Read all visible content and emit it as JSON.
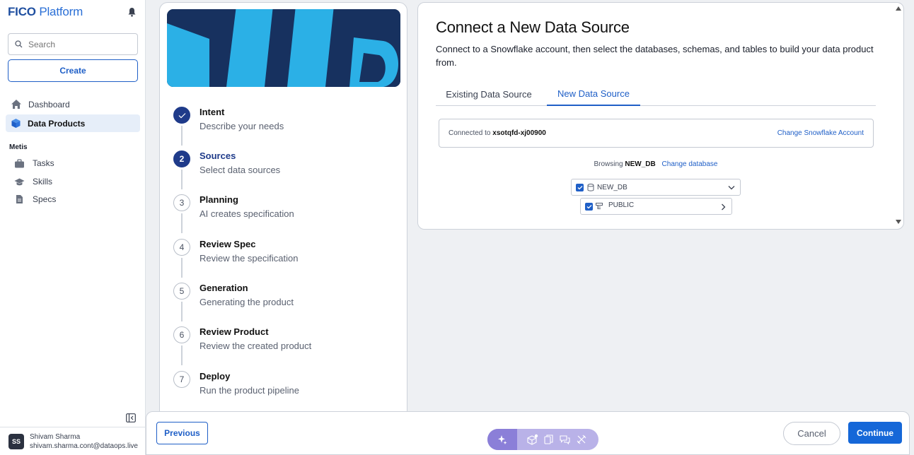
{
  "app": {
    "brand_bold": "FICO",
    "brand_rest": "Platform"
  },
  "sidebar": {
    "search_placeholder": "Search",
    "create_label": "Create",
    "nav": [
      {
        "label": "Dashboard",
        "icon": "home-icon"
      },
      {
        "label": "Data Products",
        "icon": "cube-icon"
      }
    ],
    "section": "Metis",
    "sub_nav": [
      {
        "label": "Tasks",
        "icon": "briefcase-icon"
      },
      {
        "label": "Skills",
        "icon": "graduation-cap-icon"
      },
      {
        "label": "Specs",
        "icon": "document-icon"
      }
    ],
    "user": {
      "initials": "SS",
      "name": "Shivam Sharma",
      "email": "shivam.sharma.cont@dataops.live"
    }
  },
  "steps": [
    {
      "number": "1",
      "title": "Intent",
      "desc": "Describe your needs",
      "state": "done"
    },
    {
      "number": "2",
      "title": "Sources",
      "desc": "Select data sources",
      "state": "current"
    },
    {
      "number": "3",
      "title": "Planning",
      "desc": "AI creates specification",
      "state": "pending"
    },
    {
      "number": "4",
      "title": "Review Spec",
      "desc": "Review the specification",
      "state": "pending"
    },
    {
      "number": "5",
      "title": "Generation",
      "desc": "Generating the product",
      "state": "pending"
    },
    {
      "number": "6",
      "title": "Review Product",
      "desc": "Review the created product",
      "state": "pending"
    },
    {
      "number": "7",
      "title": "Deploy",
      "desc": "Run the product pipeline",
      "state": "pending"
    }
  ],
  "main": {
    "title": "Connect a New Data Source",
    "subtitle": "Connect to a Snowflake account, then select the databases, schemas, and tables to build your data product from.",
    "tabs": [
      {
        "label": "Existing Data Source",
        "active": false
      },
      {
        "label": "New Data Source",
        "active": true
      }
    ],
    "connected_prefix": "Connected to",
    "connected_account": "xsotqfd-xj00900",
    "change_account": "Change Snowflake Account",
    "browsing_prefix": "Browsing",
    "browsing_db": "NEW_DB",
    "change_db": "Change database",
    "tree": [
      {
        "label": "NEW_DB",
        "icon": "database-icon",
        "checked": true
      },
      {
        "label": "PUBLIC",
        "icon": "schema-icon",
        "checked": true
      }
    ]
  },
  "footer": {
    "previous": "Previous",
    "cancel": "Cancel",
    "continue": "Continue",
    "tools": [
      "sparkle-icon",
      "cube-icon",
      "copy-icon",
      "chat-icon",
      "tools-icon"
    ]
  },
  "colors": {
    "accent": "#1567d8",
    "step_active": "#1f3b8a",
    "banner_dark": "#17315f",
    "banner_light": "#2bb0e6",
    "tool_pill": "#b9b2e8"
  }
}
